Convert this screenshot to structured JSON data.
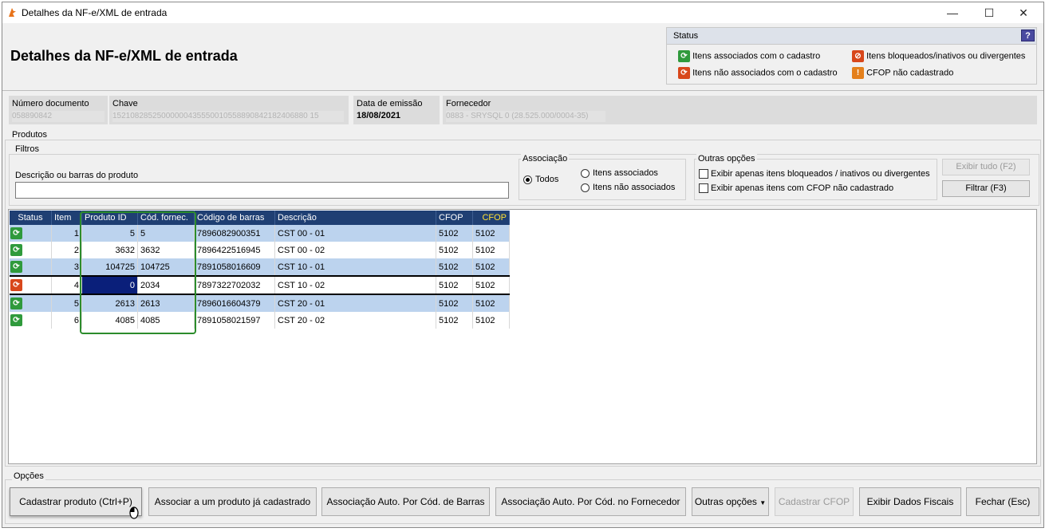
{
  "window": {
    "title": "Detalhes da NF-e/XML de entrada",
    "minimize": "—",
    "maximize": "☐",
    "close": "✕"
  },
  "header": {
    "title": "Detalhes da NF-e/XML de entrada"
  },
  "status_legend": {
    "title": "Status",
    "help": "?",
    "items": [
      {
        "label": "Itens associados com o cadastro",
        "icon": "green-sync-icon",
        "color": "#2f9a3c"
      },
      {
        "label": "Itens bloqueados/inativos ou divergentes",
        "icon": "blocked-icon",
        "color": "#d8471b"
      },
      {
        "label": "Itens não associados com o cadastro",
        "icon": "red-sync-icon",
        "color": "#d8471b"
      },
      {
        "label": "CFOP não cadastrado",
        "icon": "warning-icon",
        "color": "#e4801c"
      }
    ]
  },
  "document_info": {
    "numero_label": "Número documento",
    "numero_value": "058890842",
    "chave_label": "Chave",
    "chave_value": "15210828525000000435550010558890842182406880 15",
    "data_label": "Data de emissão",
    "data_value": "18/08/2021",
    "fornecedor_label": "Fornecedor",
    "fornecedor_value": "0883 - SRYSQL 0 (28.525.000/0004-35)"
  },
  "produtos": {
    "group_label": "Produtos",
    "filtros_label": "Filtros",
    "search_label": "Descrição ou barras do produto",
    "search_value": "",
    "associacao_label": "Associação",
    "radio_todos": "Todos",
    "radio_associados": "Itens associados",
    "radio_nao_associados": "Itens não associados",
    "outras_label": "Outras opções",
    "chk_bloqueados": "Exibir apenas itens bloqueados / inativos ou divergentes",
    "chk_cfop": "Exibir apenas itens com CFOP não cadastrado",
    "btn_exibir_tudo": "Exibir tudo (F2)",
    "btn_filtrar": "Filtrar (F3)"
  },
  "grid": {
    "columns": [
      "Status",
      "Item",
      "Produto ID",
      "Cód. fornec.",
      "Código de barras",
      "Descrição",
      "CFOP",
      "CFOP"
    ],
    "rows": [
      {
        "status": "associated",
        "item": "1",
        "produto_id": "5",
        "cod_fornec": "5",
        "barras": "7896082900351",
        "descricao": "CST 00 - 01",
        "cfop1": "5102",
        "cfop2": "5102"
      },
      {
        "status": "associated",
        "item": "2",
        "produto_id": "3632",
        "cod_fornec": "3632",
        "barras": "7896422516945",
        "descricao": "CST 00 - 02",
        "cfop1": "5102",
        "cfop2": "5102"
      },
      {
        "status": "associated",
        "item": "3",
        "produto_id": "104725",
        "cod_fornec": "104725",
        "barras": "7891058016609",
        "descricao": "CST 10 - 01",
        "cfop1": "5102",
        "cfop2": "5102"
      },
      {
        "status": "not_associated",
        "item": "4",
        "produto_id": "0",
        "cod_fornec": "2034",
        "barras": "7897322702032",
        "descricao": "CST 10 - 02",
        "cfop1": "5102",
        "cfop2": "5102"
      },
      {
        "status": "associated",
        "item": "5",
        "produto_id": "2613",
        "cod_fornec": "2613",
        "barras": "7896016604379",
        "descricao": "CST 20 - 01",
        "cfop1": "5102",
        "cfop2": "5102"
      },
      {
        "status": "associated",
        "item": "6",
        "produto_id": "4085",
        "cod_fornec": "4085",
        "barras": "7891058021597",
        "descricao": "CST 20 - 02",
        "cfop1": "5102",
        "cfop2": "5102"
      }
    ]
  },
  "opcoes": {
    "label": "Opções",
    "btn_cadastrar": "Cadastrar produto (Ctrl+P)",
    "btn_associar": "Associar a um produto já cadastrado",
    "btn_auto_barras": "Associação Auto. Por Cód. de Barras",
    "btn_auto_fornecedor": "Associação Auto. Por Cód. no Fornecedor",
    "btn_outras": "Outras opções",
    "btn_cadastrar_cfop": "Cadastrar CFOP",
    "btn_dados_fiscais": "Exibir Dados Fiscais",
    "btn_fechar": "Fechar (Esc)"
  }
}
